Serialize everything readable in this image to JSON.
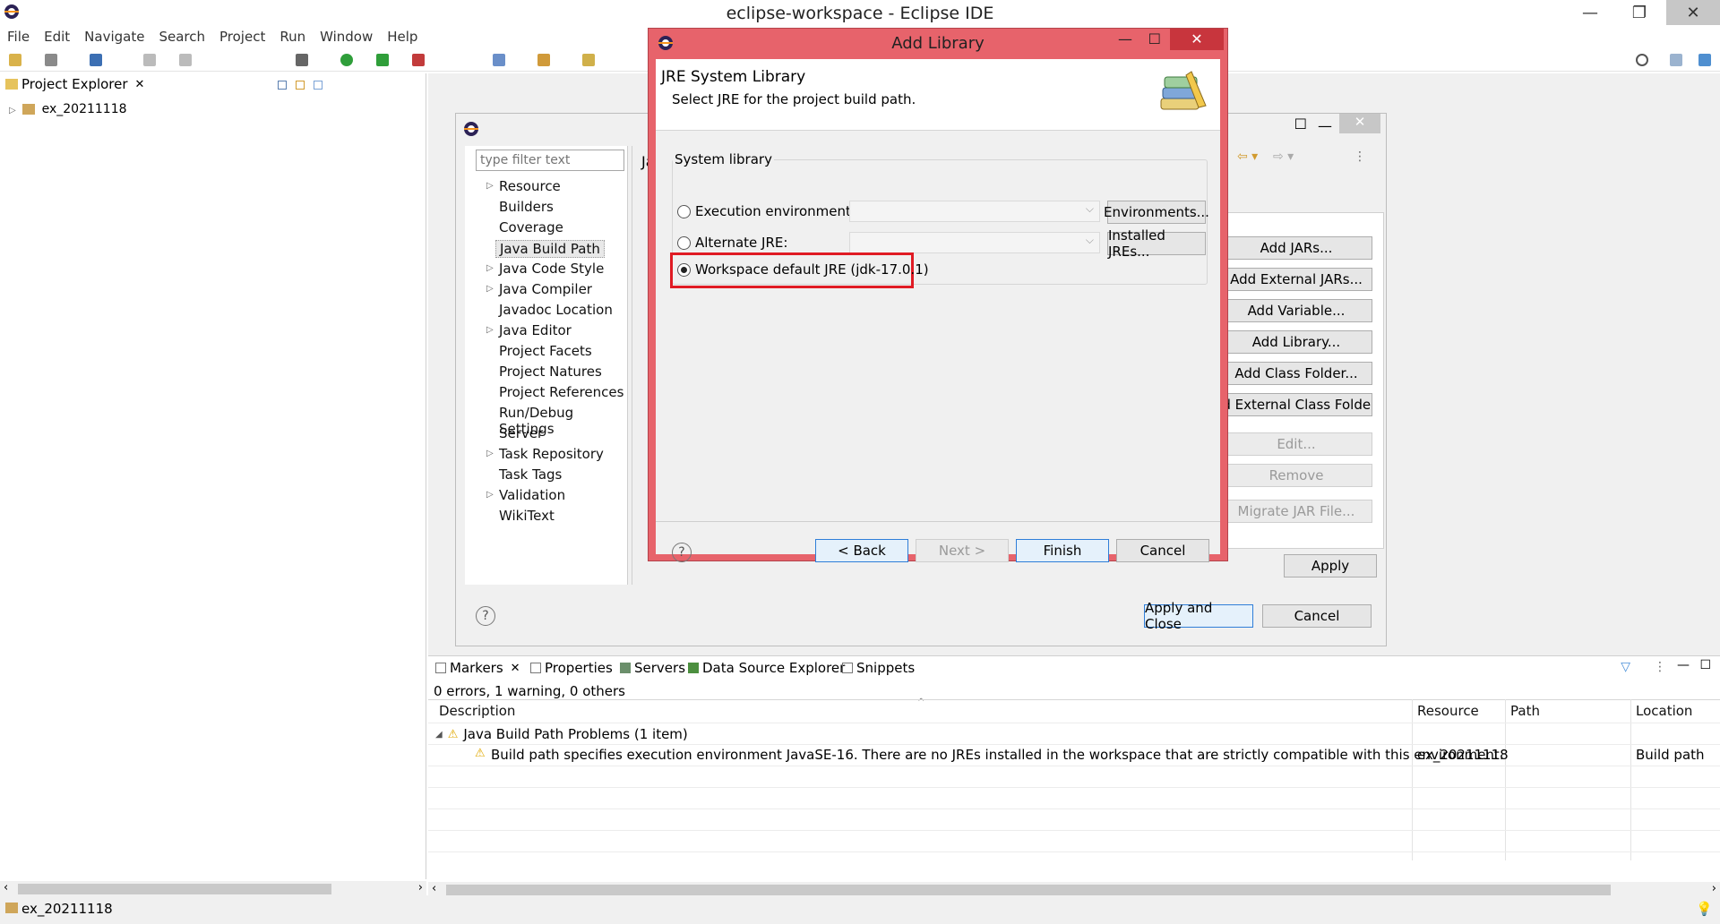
{
  "window": {
    "title": "eclipse-workspace - Eclipse IDE"
  },
  "menu": [
    "File",
    "Edit",
    "Navigate",
    "Search",
    "Project",
    "Run",
    "Window",
    "Help"
  ],
  "explorer": {
    "tab_label": "Project Explorer",
    "project": "ex_20211118"
  },
  "properties": {
    "filter_placeholder": "type filter text",
    "title_fragment": "Ja",
    "items": [
      {
        "label": "Resource",
        "expandable": true
      },
      {
        "label": "Builders",
        "expandable": false
      },
      {
        "label": "Coverage",
        "expandable": false
      },
      {
        "label": "Java Build Path",
        "expandable": false,
        "selected": true
      },
      {
        "label": "Java Code Style",
        "expandable": true
      },
      {
        "label": "Java Compiler",
        "expandable": true
      },
      {
        "label": "Javadoc Location",
        "expandable": false
      },
      {
        "label": "Java Editor",
        "expandable": true
      },
      {
        "label": "Project Facets",
        "expandable": false
      },
      {
        "label": "Project Natures",
        "expandable": false
      },
      {
        "label": "Project References",
        "expandable": false
      },
      {
        "label": "Run/Debug Settings",
        "expandable": false
      },
      {
        "label": "Server",
        "expandable": false
      },
      {
        "label": "Task Repository",
        "expandable": true
      },
      {
        "label": "Task Tags",
        "expandable": false
      },
      {
        "label": "Validation",
        "expandable": true
      },
      {
        "label": "WikiText",
        "expandable": false
      }
    ],
    "side_buttons": [
      {
        "label": "Add JARs...",
        "enabled": true
      },
      {
        "label": "Add External JARs...",
        "enabled": true
      },
      {
        "label": "Add Variable...",
        "enabled": true
      },
      {
        "label": "Add Library...",
        "enabled": true
      },
      {
        "label": "Add Class Folder...",
        "enabled": true
      },
      {
        "label": "Add External Class Folder...",
        "enabled": true
      },
      {
        "label": "Edit...",
        "enabled": false
      },
      {
        "label": "Remove",
        "enabled": false
      },
      {
        "label": "Migrate JAR File...",
        "enabled": false
      }
    ],
    "apply": "Apply",
    "apply_close": "Apply and Close",
    "cancel": "Cancel"
  },
  "add_library": {
    "title": "Add Library",
    "header_title": "JRE System Library",
    "header_desc": "Select JRE for the project build path.",
    "group_label": "System library",
    "opt_exec_env": "Execution environment:",
    "opt_alt_jre": "Alternate JRE:",
    "opt_workspace": "Workspace default JRE (jdk-17.0.1)",
    "environments_btn": "Environments...",
    "installed_btn": "Installed JREs...",
    "back": "< Back",
    "next": "Next >",
    "finish": "Finish",
    "cancel": "Cancel",
    "highlight_color": "#e01b24"
  },
  "markers": {
    "tabs": [
      "Markers",
      "Properties",
      "Servers",
      "Data Source Explorer",
      "Snippets"
    ],
    "summary": "0 errors, 1 warning, 0 others",
    "columns": [
      "Description",
      "Resource",
      "Path",
      "Location"
    ],
    "group": "Java Build Path Problems (1 item)",
    "row": {
      "description": "Build path specifies execution environment JavaSE-16. There are no JREs installed in the workspace that are strictly compatible with this environment.",
      "resource": "ex_20211118",
      "path": "",
      "location": "Build path"
    }
  },
  "status": {
    "text": "ex_20211118"
  }
}
